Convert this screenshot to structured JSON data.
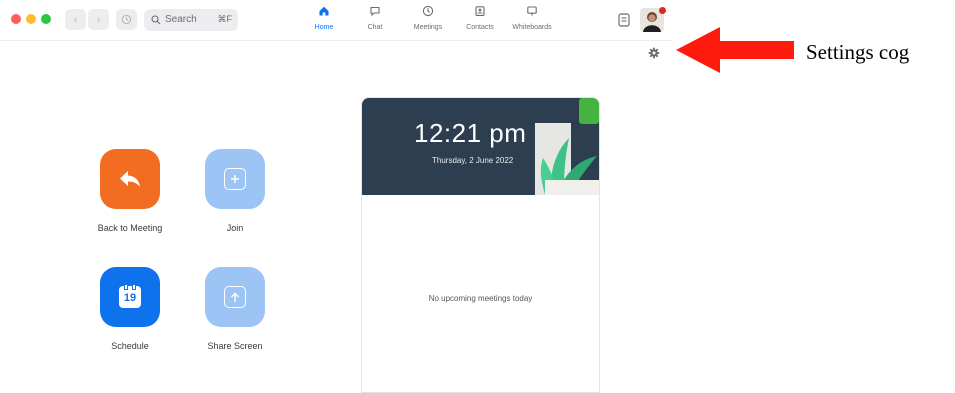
{
  "search": {
    "label": "Search",
    "shortcut": "⌘F"
  },
  "nav": [
    {
      "label": "Home",
      "icon": "home-icon",
      "active": true
    },
    {
      "label": "Chat",
      "icon": "chat-icon",
      "active": false
    },
    {
      "label": "Meetings",
      "icon": "clock-icon",
      "active": false
    },
    {
      "label": "Contacts",
      "icon": "contacts-icon",
      "active": false
    },
    {
      "label": "Whiteboards",
      "icon": "whiteboard-icon",
      "active": false
    }
  ],
  "actions": [
    {
      "label": "Back to Meeting",
      "color": "#f26d21",
      "icon": "back-arrow-icon"
    },
    {
      "label": "Join",
      "color": "#9cc4f4",
      "icon": "plus-icon"
    },
    {
      "label": "Schedule",
      "color": "#0e72ed",
      "icon": "calendar-icon",
      "calendar_day": "19"
    },
    {
      "label": "Share Screen",
      "color": "#9cc4f4",
      "icon": "upload-arrow-icon"
    }
  ],
  "clock": {
    "time": "12:21 pm",
    "date": "Thursday, 2 June 2022"
  },
  "meetings": {
    "empty_text": "No upcoming meetings today"
  },
  "annotation": {
    "label": "Settings cog",
    "color": "#ff1a0e"
  },
  "colors": {
    "accent": "#0e72ed",
    "card_header": "#2d3e50"
  }
}
